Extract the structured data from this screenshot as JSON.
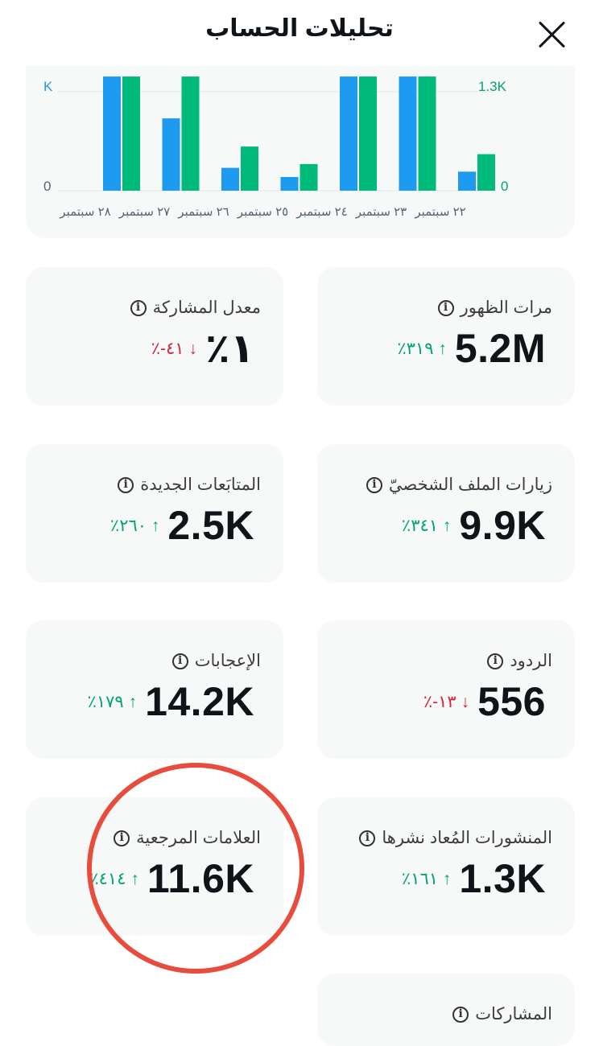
{
  "header": {
    "title": "تحليلات الحساب"
  },
  "chart_data": {
    "type": "bar",
    "categories": [
      "٢٢ سبتمبر",
      "٢٣ سبتمبر",
      "٢٤ سبتمبر",
      "٢٥ سبتمبر",
      "٢٦ سبتمبر",
      "٢٧ سبتمبر",
      "٢٨ سبتمبر"
    ],
    "series": [
      {
        "values": [
          1.7,
          0.95,
          0.3,
          0.18,
          1.7,
          1.7,
          0.25
        ]
      },
      {
        "values": [
          1.7,
          1.7,
          0.58,
          0.35,
          1.7,
          1.7,
          0.48
        ]
      }
    ],
    "left_axis_ticks": [
      "0",
      "K"
    ],
    "right_axis_ticks": [
      "0",
      "1.3K"
    ],
    "ylim": [
      0,
      1.3
    ],
    "grid": true,
    "colors": [
      "#1d9bf0",
      "#00ba7c"
    ]
  },
  "metrics": [
    {
      "label": "مرات الظهور",
      "value": "5.2M",
      "delta": "٪٣١٩",
      "direction": "up"
    },
    {
      "label": "معدل المشاركة",
      "value": "٪١",
      "delta": "٪-٤١",
      "direction": "down"
    },
    {
      "label": "زيارات الملف الشخصيّ",
      "value": "9.9K",
      "delta": "٪٣٤١",
      "direction": "up"
    },
    {
      "label": "المتابَعات الجديدة",
      "value": "2.5K",
      "delta": "٪٢٦٠",
      "direction": "up"
    },
    {
      "label": "الردود",
      "value": "556",
      "delta": "٪-١٣",
      "direction": "down"
    },
    {
      "label": "الإعجابات",
      "value": "14.2K",
      "delta": "٪١٧٩",
      "direction": "up"
    },
    {
      "label": "المنشورات المُعاد نشرها",
      "value": "1.3K",
      "delta": "٪١٦١",
      "direction": "up"
    },
    {
      "label": "العلامات المرجعية",
      "value": "11.6K",
      "delta": "٪٤١٤",
      "direction": "up"
    },
    {
      "label": "المشاركات"
    }
  ],
  "icons": {
    "close": "close-icon",
    "info": "info-icon",
    "up": "arrow-up-icon",
    "down": "arrow-down-icon"
  }
}
